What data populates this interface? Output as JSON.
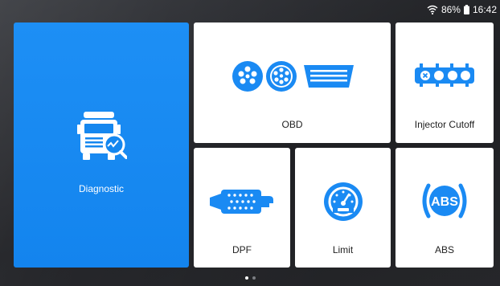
{
  "status": {
    "battery": "86%",
    "time": "16:42"
  },
  "tiles": {
    "diagnostic": "Diagnostic",
    "obd": "OBD",
    "injector_cutoff": "Injector Cutoff",
    "dpf": "DPF",
    "limit": "Limit",
    "abs": "ABS",
    "abs_badge": "ABS"
  },
  "pager": {
    "pages": 2,
    "current": 1
  },
  "colors": {
    "accent": "#1a8af3",
    "tile": "#ffffff",
    "background": "#2b2d31"
  },
  "icons": [
    "wifi-icon",
    "battery-icon",
    "truck-diagnostic-icon",
    "obd-connectors-icon",
    "injector-icon",
    "dpf-icon",
    "speedometer-icon",
    "abs-icon"
  ]
}
